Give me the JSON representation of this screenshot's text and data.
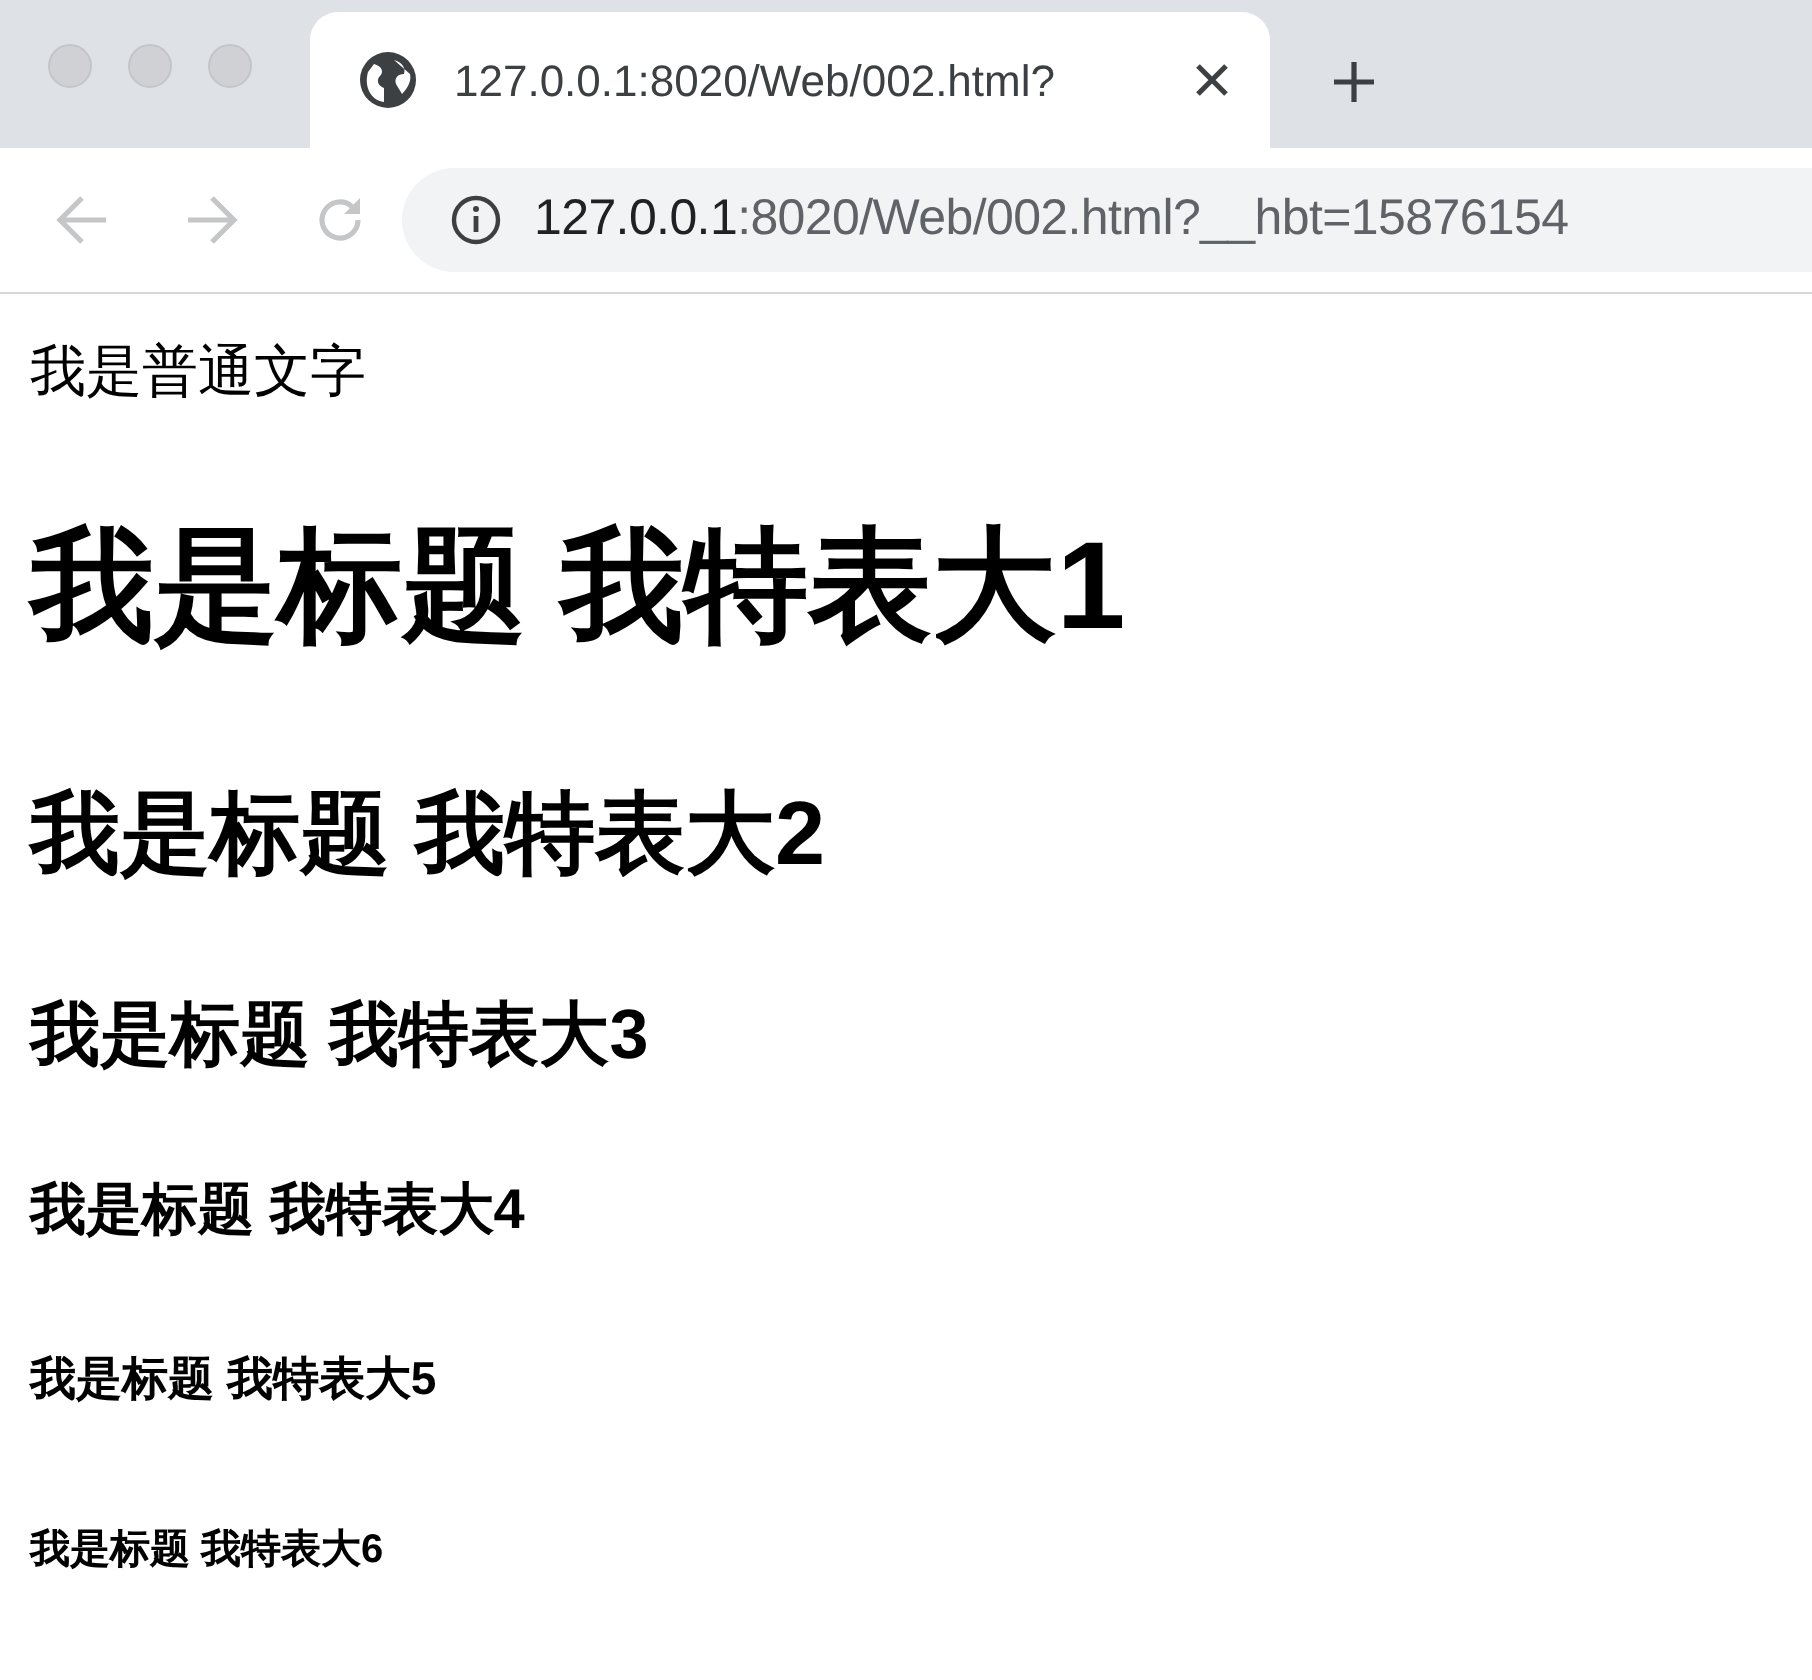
{
  "tabs": [
    {
      "title": "127.0.0.1:8020/Web/002.html?",
      "selected": true
    }
  ],
  "address": {
    "host": "127.0.0.1",
    "path": ":8020/Web/002.html?__hbt=15876154"
  },
  "content": [
    {
      "kind": "p",
      "text": "我是普通文字"
    },
    {
      "kind": "h1",
      "text": "我是标题 我特表大1"
    },
    {
      "kind": "h2",
      "text": "我是标题 我特表大2"
    },
    {
      "kind": "h3",
      "text": "我是标题 我特表大3"
    },
    {
      "kind": "h4",
      "text": "我是标题 我特表大4"
    },
    {
      "kind": "h5",
      "text": "我是标题 我特表大5"
    },
    {
      "kind": "h6",
      "text": "我是标题 我特表大6"
    }
  ]
}
